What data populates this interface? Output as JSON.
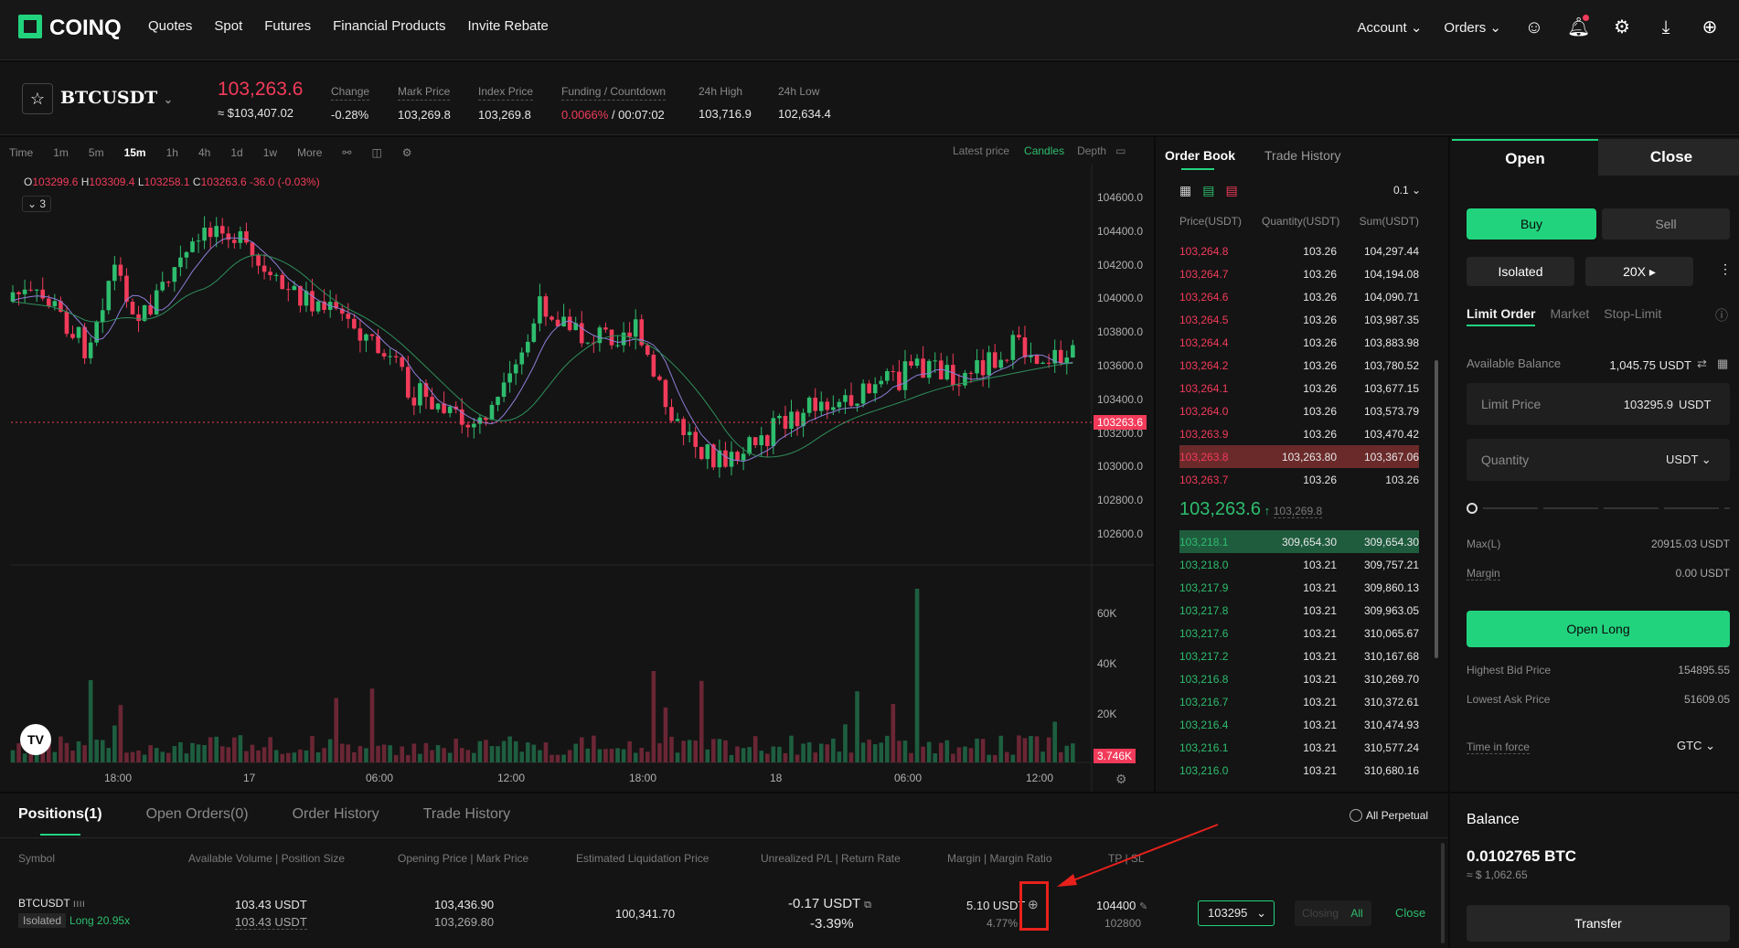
{
  "nav": {
    "brand": "COINQ",
    "items": [
      "Quotes",
      "Spot",
      "Futures",
      "Financial Products",
      "Invite Rebate"
    ],
    "account": "Account",
    "orders": "Orders"
  },
  "ticker": {
    "symbol": "BTCUSDT",
    "last": "103,263.6",
    "last_usd": "≈ $103,407.02",
    "stats": [
      {
        "label": "Change",
        "value": "-0.28%",
        "color": "red"
      },
      {
        "label": "Mark Price",
        "value": "103,269.8"
      },
      {
        "label": "Index Price",
        "value": "103,269.8"
      },
      {
        "label": "Funding / Countdown",
        "value": "0.0066%",
        "value2": "/ 00:07:02"
      },
      {
        "label": "24h High",
        "value": "103,716.9"
      },
      {
        "label": "24h Low",
        "value": "102,634.4"
      }
    ]
  },
  "chart": {
    "timeframes": [
      "Time",
      "1m",
      "5m",
      "15m",
      "1h",
      "4h",
      "1d",
      "1w",
      "More"
    ],
    "active": "15m",
    "latest_label": "Latest price",
    "candles_label": "Candles",
    "depth_label": "Depth",
    "ohlc": {
      "o": "103299.6",
      "h": "103309.4",
      "l": "103258.1",
      "c": "103263.6",
      "chg": "-36.0 (-0.03%)"
    },
    "indicator_count": "3",
    "price_ticks": [
      "104600.0",
      "104400.0",
      "104200.0",
      "104000.0",
      "103800.0",
      "103600.0",
      "103400.0",
      "103200.0",
      "103000.0",
      "102800.0",
      "102600.0"
    ],
    "current_price_tag": "103263.6",
    "vol_ticks": [
      "60K",
      "40K",
      "20K"
    ],
    "vol_tag": "3.746K",
    "time_ticks": [
      "18:00",
      "17",
      "06:00",
      "12:00",
      "18:00",
      "18",
      "06:00",
      "12:00"
    ]
  },
  "orderbook": {
    "tabs": [
      "Order Book",
      "Trade History"
    ],
    "precision": "0.1",
    "headers": [
      "Price(USDT)",
      "Quantity(USDT)",
      "Sum(USDT)"
    ],
    "asks": [
      [
        "103,264.8",
        "103.26",
        "104,297.44"
      ],
      [
        "103,264.7",
        "103.26",
        "104,194.08"
      ],
      [
        "103,264.6",
        "103.26",
        "104,090.71"
      ],
      [
        "103,264.5",
        "103.26",
        "103,987.35"
      ],
      [
        "103,264.4",
        "103.26",
        "103,883.98"
      ],
      [
        "103,264.2",
        "103.26",
        "103,780.52"
      ],
      [
        "103,264.1",
        "103.26",
        "103,677.15"
      ],
      [
        "103,264.0",
        "103.26",
        "103,573.79"
      ],
      [
        "103,263.9",
        "103.26",
        "103,470.42"
      ],
      [
        "103,263.8",
        "103,263.80",
        "103,367.06"
      ],
      [
        "103,263.7",
        "103.26",
        "103.26"
      ]
    ],
    "mid": "103,263.6",
    "mid_mark": "103,269.8",
    "bids": [
      [
        "103,218.1",
        "309,654.30",
        "309,654.30"
      ],
      [
        "103,218.0",
        "103.21",
        "309,757.21"
      ],
      [
        "103,217.9",
        "103.21",
        "309,860.13"
      ],
      [
        "103,217.8",
        "103.21",
        "309,963.05"
      ],
      [
        "103,217.6",
        "103.21",
        "310,065.67"
      ],
      [
        "103,217.2",
        "103.21",
        "310,167.68"
      ],
      [
        "103,216.8",
        "103.21",
        "310,269.70"
      ],
      [
        "103,216.7",
        "103.21",
        "310,372.61"
      ],
      [
        "103,216.4",
        "103.21",
        "310,474.93"
      ],
      [
        "103,216.1",
        "103.21",
        "310,577.24"
      ],
      [
        "103,216.0",
        "103.21",
        "310,680.16"
      ]
    ]
  },
  "order": {
    "open": "Open",
    "close": "Close",
    "buy": "Buy",
    "sell": "Sell",
    "margin_mode": "Isolated",
    "leverage": "20X",
    "types": [
      "Limit Order",
      "Market",
      "Stop-Limit"
    ],
    "available_label": "Available Balance",
    "available": "1,045.75 USDT",
    "limit_price_label": "Limit Price",
    "limit_price": "103295.9",
    "unit": "USDT",
    "quantity_label": "Quantity",
    "max_label": "Max(L)",
    "max": "20915.03 USDT",
    "margin_label": "Margin",
    "margin": "0.00 USDT",
    "open_long": "Open Long",
    "bid_label": "Highest Bid Price",
    "bid": "154895.55",
    "ask_label": "Lowest Ask Price",
    "ask": "51609.05",
    "tif_label": "Time in force",
    "tif": "GTC"
  },
  "positions": {
    "tabs": [
      "Positions(1)",
      "Open Orders(0)",
      "Order History",
      "Trade History"
    ],
    "all_perpetual": "All Perpetual",
    "headers": [
      "Symbol",
      "Available Volume | Position Size",
      "Opening Price | Mark Price",
      "Estimated Liquidation Price",
      "Unrealized P/L | Return Rate",
      "Margin | Margin Ratio",
      "TP | SL"
    ],
    "row": {
      "symbol": "BTCUSDT",
      "mode": "Isolated",
      "side": "Long 20.95x",
      "avail": "103.43 USDT",
      "size": "103.43 USDT",
      "open": "103,436.90",
      "mark": "103,269.80",
      "liq": "100,341.70",
      "pnl": "-0.17 USDT",
      "rate": "-3.39%",
      "margin": "5.10 USDT",
      "ratio": "4.77%",
      "tp": "104400",
      "sl": "102800",
      "close_price": "103295",
      "closing": "Closing",
      "all": "All",
      "close": "Close"
    }
  },
  "balance": {
    "title": "Balance",
    "btc": "0.0102765 BTC",
    "usd": "≈ $ 1,062.65",
    "transfer": "Transfer"
  },
  "colors": {
    "accent": "#22d37e",
    "up": "#2ebd6e",
    "down": "#f23b5a"
  }
}
